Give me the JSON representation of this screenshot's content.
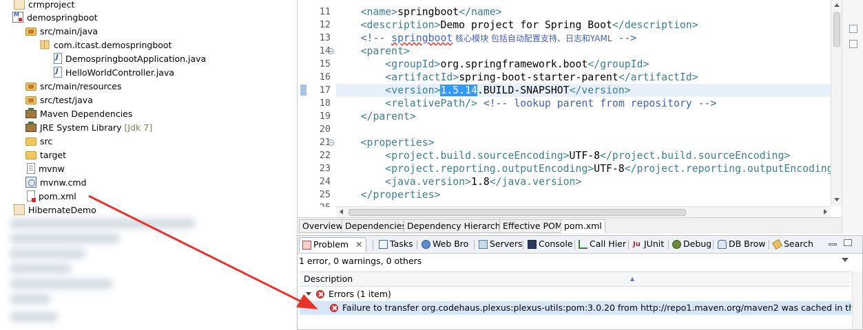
{
  "explorer": {
    "items": [
      {
        "label": "crmproject",
        "icon": "project-icon"
      },
      {
        "label": "demospringboot",
        "icon": "maven-project-icon"
      },
      {
        "label": "src/main/java",
        "icon": "source-folder-icon"
      },
      {
        "label": "com.itcast.demospringboot",
        "icon": "package-icon"
      },
      {
        "label": "DemospringbootApplication.java",
        "icon": "java-file-icon"
      },
      {
        "label": "HelloWorldController.java",
        "icon": "java-file-icon"
      },
      {
        "label": "src/main/resources",
        "icon": "source-folder-icon"
      },
      {
        "label": "src/test/java",
        "icon": "source-folder-icon"
      },
      {
        "label": "Maven Dependencies",
        "icon": "library-icon"
      },
      {
        "label": "JRE System Library",
        "decoration": "[Jdk 7]",
        "icon": "library-icon"
      },
      {
        "label": "src",
        "icon": "folder-icon"
      },
      {
        "label": "target",
        "icon": "folder-icon"
      },
      {
        "label": "mvnw",
        "icon": "file-icon"
      },
      {
        "label": "mvnw.cmd",
        "icon": "cmd-file-icon"
      },
      {
        "label": "pom.xml",
        "icon": "xml-file-icon"
      },
      {
        "label": "HibernateDemo",
        "icon": "project-icon"
      }
    ]
  },
  "editor": {
    "line_numbers": [
      "11",
      "12",
      "13",
      "14",
      "15",
      "16",
      "17",
      "18",
      "19",
      "20",
      "21",
      "22",
      "23",
      "24",
      "25"
    ],
    "lines": {
      "l11": {
        "open": "<name>",
        "text": "springboot",
        "close": "</name>"
      },
      "l12": {
        "open": "<description>",
        "text": "Demo project for Spring Boot",
        "close": "</description>"
      },
      "l13": {
        "start": "<!-- ",
        "word": "springboot",
        "cjk": " 核心模块 包括自动配置支持、日志和YAML",
        "end": " -->"
      },
      "l14": {
        "open": "<parent>"
      },
      "l15": {
        "open": "<groupId>",
        "text": "org.springframework.boot",
        "close": "</groupId>"
      },
      "l16": {
        "open": "<artifactId>",
        "text": "spring-boot-starter-parent",
        "close": "</artifactId>"
      },
      "l17": {
        "open": "<version>",
        "selected": "1.5.14",
        "text": ".BUILD-SNAPSHOT",
        "close": "</version>"
      },
      "l18": {
        "open": "<relativePath/>",
        "comment": " <!-- lookup parent from repository -->"
      },
      "l19": {
        "close": "</parent>"
      },
      "l21": {
        "open": "<properties>"
      },
      "l22": {
        "open": "<project.build.sourceEncoding>",
        "text": "UTF-8",
        "close": "</project.build.sourceEncoding>"
      },
      "l23": {
        "open": "<project.reporting.outputEncoding>",
        "text": "UTF-8",
        "close": "</project.reporting.outputEncoding>"
      },
      "l24": {
        "open": "<java.version>",
        "text": "1.8",
        "close": "</java.version>"
      },
      "l25": {
        "close": "</properties>"
      }
    },
    "pom_tabs": [
      "Overview",
      "Dependencies",
      "Dependency Hierarchy",
      "Effective POM",
      "pom.xml"
    ],
    "active_pom_tab": "pom.xml"
  },
  "problems_view": {
    "tabs": [
      {
        "label": "Problem",
        "icon": "problems-icon",
        "active": true
      },
      {
        "label": "Tasks",
        "icon": "tasks-icon"
      },
      {
        "label": "Web Bro",
        "icon": "globe-icon"
      },
      {
        "label": "Servers",
        "icon": "servers-icon"
      },
      {
        "label": "Console",
        "icon": "console-icon"
      },
      {
        "label": "Call Hier",
        "icon": "call-hierarchy-icon"
      },
      {
        "label": "JUnit",
        "icon": "junit-icon"
      },
      {
        "label": "Debug",
        "icon": "debug-icon"
      },
      {
        "label": "DB Brow",
        "icon": "db-browser-icon"
      },
      {
        "label": "Search",
        "icon": "search-icon"
      }
    ],
    "summary": "1 error, 0 warnings, 0 others",
    "column_header": "Description",
    "group_label": "Errors (1 item)",
    "error_message": "Failure to transfer org.codehaus.plexus:plexus-utils:pom:3.0.20 from http://repo1.maven.org/maven2 was cached in the local re"
  },
  "colors": {
    "tag": "#3a7f96",
    "comment": "#3f5fbf",
    "selection": "#3399ff",
    "annotation_arrow": "#e8332a",
    "error": "#e04040"
  }
}
